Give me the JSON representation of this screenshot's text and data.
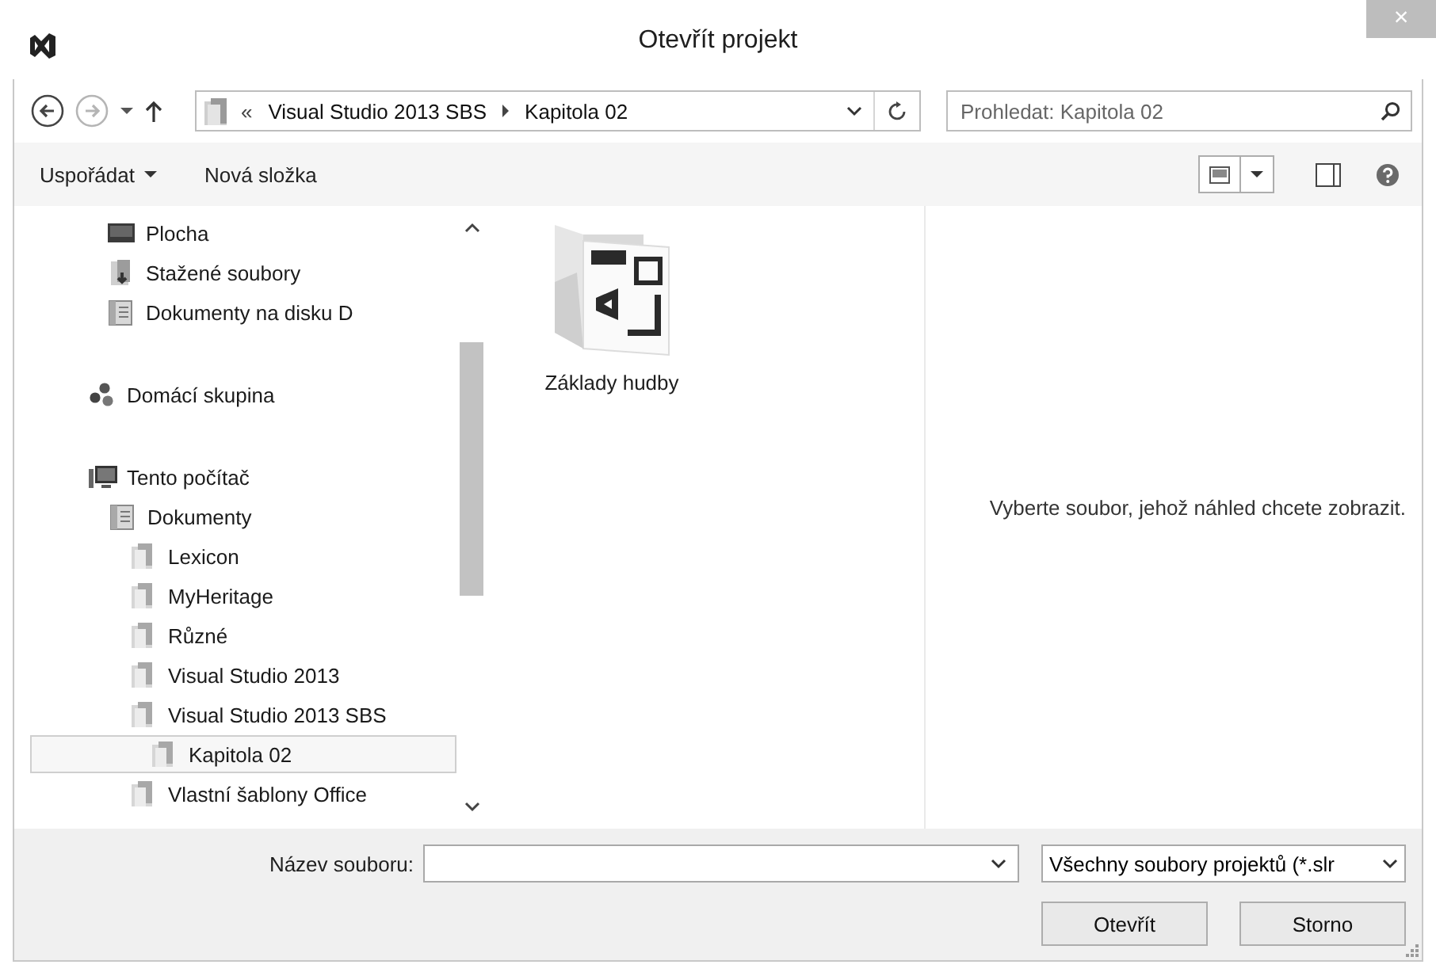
{
  "window": {
    "title": "Otevřít projekt",
    "close": "×"
  },
  "nav": {
    "back": {
      "disabled": false
    },
    "forward": {
      "disabled": true
    },
    "overflow": "«",
    "breadcrumbs": [
      {
        "label": "Visual Studio 2013 SBS"
      },
      {
        "label": "Kapitola 02"
      }
    ],
    "search": {
      "placeholder": "Prohledat: Kapitola 02"
    }
  },
  "toolbar": {
    "organize": "Uspořádat",
    "new_folder": "Nová složka"
  },
  "tree": [
    {
      "kind": "favorites",
      "items": [
        {
          "label": "Plocha",
          "kind": "desktop",
          "selected": false
        },
        {
          "label": "Stažené soubory",
          "kind": "downloads",
          "selected": false
        },
        {
          "label": "Dokumenty na disku D",
          "kind": "library",
          "selected": false
        }
      ]
    },
    {
      "kind": "homegroup",
      "items": [
        {
          "label": "Domácí skupina",
          "kind": "homegroup",
          "selected": false
        }
      ]
    },
    {
      "kind": "computer",
      "items": [
        {
          "label": "Tento počítač",
          "kind": "computer",
          "selected": false,
          "children": [
            {
              "label": "Dokumenty",
              "kind": "library",
              "selected": false,
              "children": [
                {
                  "label": "Lexicon",
                  "kind": "folder",
                  "selected": false
                },
                {
                  "label": "MyHeritage",
                  "kind": "folder",
                  "selected": false
                },
                {
                  "label": "Různé",
                  "kind": "folder",
                  "selected": false
                },
                {
                  "label": "Visual Studio 2013",
                  "kind": "folder",
                  "selected": false
                },
                {
                  "label": "Visual Studio 2013 SBS",
                  "kind": "folder",
                  "selected": false,
                  "children": [
                    {
                      "label": "Kapitola 02",
                      "kind": "folder",
                      "selected": true
                    }
                  ]
                },
                {
                  "label": "Vlastní šablony Office",
                  "kind": "folder",
                  "selected": false
                }
              ]
            }
          ]
        }
      ]
    }
  ],
  "files": [
    {
      "name": "Základy hudby",
      "kind": "project-folder"
    }
  ],
  "preview": {
    "message": "Vyberte soubor, jehož náhled chcete zobrazit."
  },
  "footer": {
    "filename_label": "Název souboru:",
    "filetype": "Všechny soubory projektů (*.slr",
    "buttons": [
      "Otevřít",
      "Storno"
    ]
  }
}
